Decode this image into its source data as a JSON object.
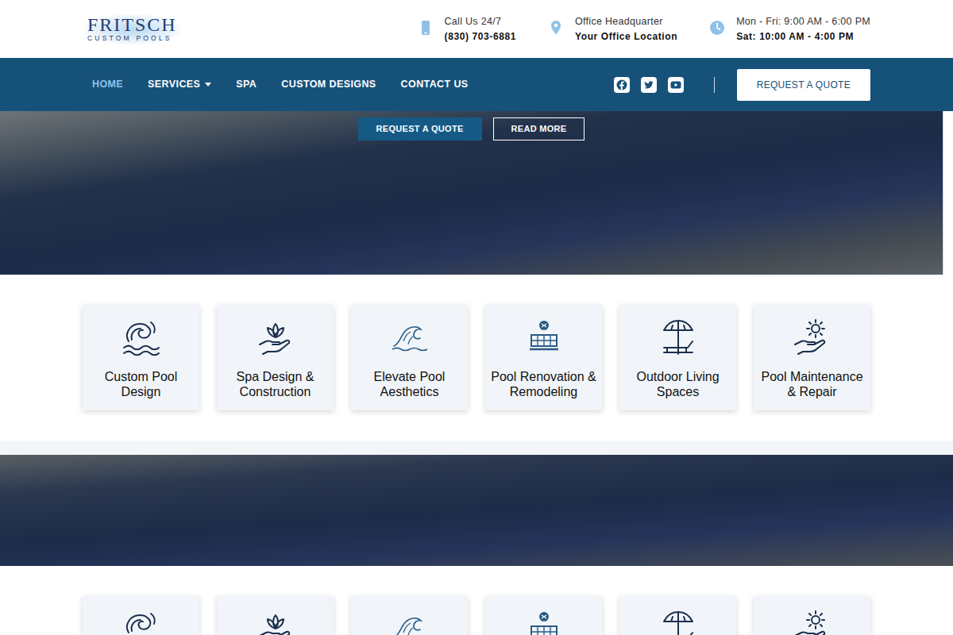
{
  "logo": {
    "name": "FRITSCH",
    "tagline": "CUSTOM POOLS"
  },
  "contacts": [
    {
      "label": "Call Us 24/7",
      "value": "(830) 703-6881"
    },
    {
      "label": "Office Headquarter",
      "value": "Your Office Location"
    },
    {
      "label": "Mon - Fri: 9:00 AM - 6:00 PM",
      "value": "Sat: 10:00 AM - 4:00 PM"
    }
  ],
  "nav": [
    {
      "label": "HOME",
      "selected": true,
      "kind": "link"
    },
    {
      "label": "SERVICES",
      "selected": false,
      "kind": "dropdown"
    },
    {
      "label": "SPA",
      "selected": false,
      "kind": "link"
    },
    {
      "label": "CUSTOM DESIGNS",
      "selected": false,
      "kind": "link"
    },
    {
      "label": "CONTACT US",
      "selected": false,
      "kind": "link"
    }
  ],
  "quote_button": "REQUEST A QUOTE",
  "hero": {
    "buttons": [
      "REQUEST A QUOTE",
      "READ MORE"
    ]
  },
  "services": [
    {
      "label": "Custom Pool Design"
    },
    {
      "label": "Spa Design & Construction"
    },
    {
      "label": "Elevate Pool Aesthetics"
    },
    {
      "label": "Pool Renovation & Remodeling"
    },
    {
      "label": "Outdoor Living Spaces"
    },
    {
      "label": "Pool Maintenance & Repair"
    }
  ]
}
